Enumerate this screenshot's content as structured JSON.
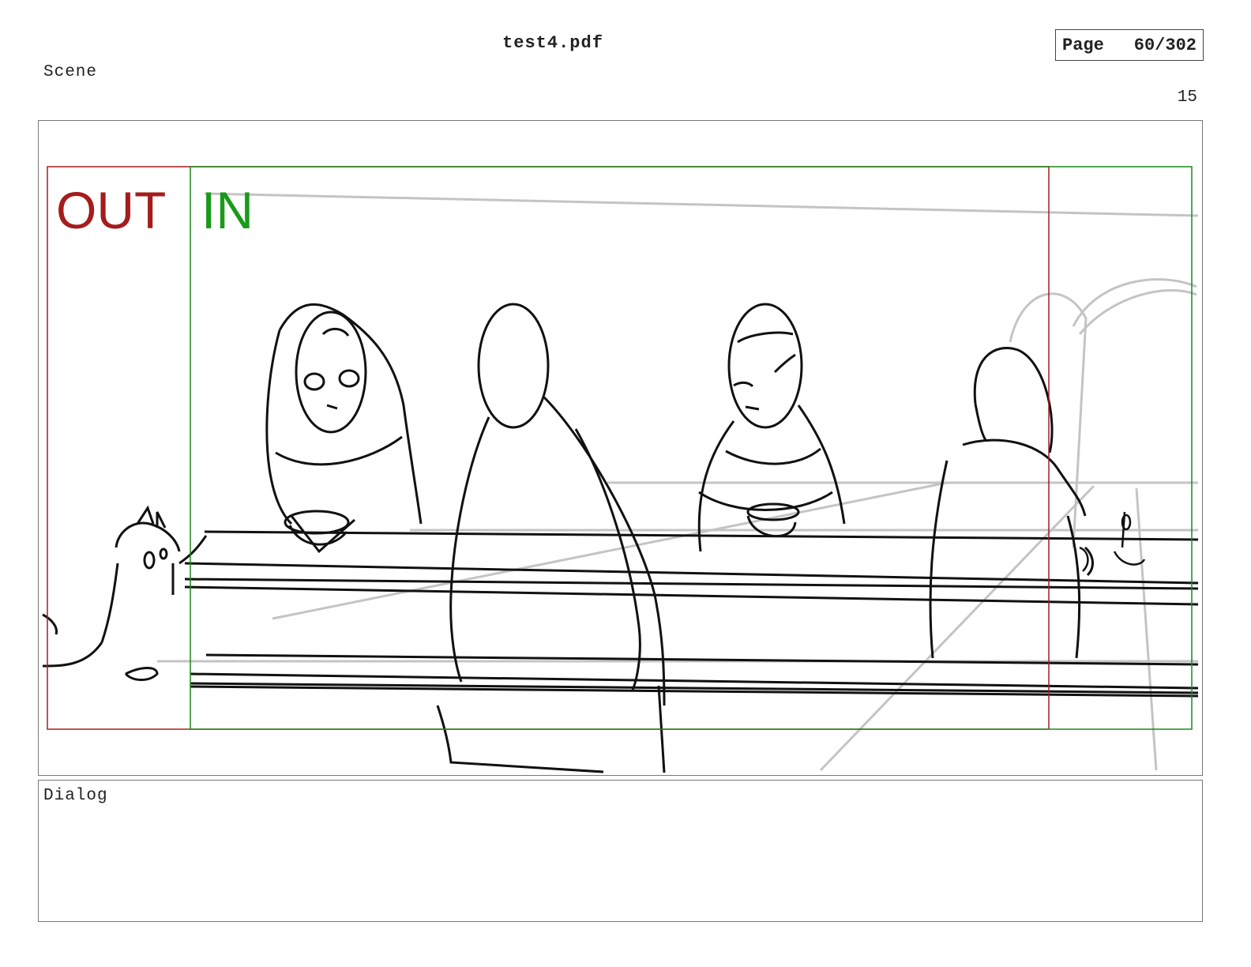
{
  "header": {
    "file_name": "test4.pdf",
    "page_label": "Page",
    "page_value": "60/302"
  },
  "scene": {
    "label": "Scene",
    "panel_number": "15"
  },
  "panel": {
    "frame_out_label": "OUT",
    "frame_in_label": "IN",
    "colors": {
      "out_frame": "#a51c1c",
      "in_frame": "#1a8a1a",
      "sketch_line": "#111111",
      "guide_line": "#c4c4c4"
    }
  },
  "dialog": {
    "label": "Dialog",
    "text": ""
  }
}
